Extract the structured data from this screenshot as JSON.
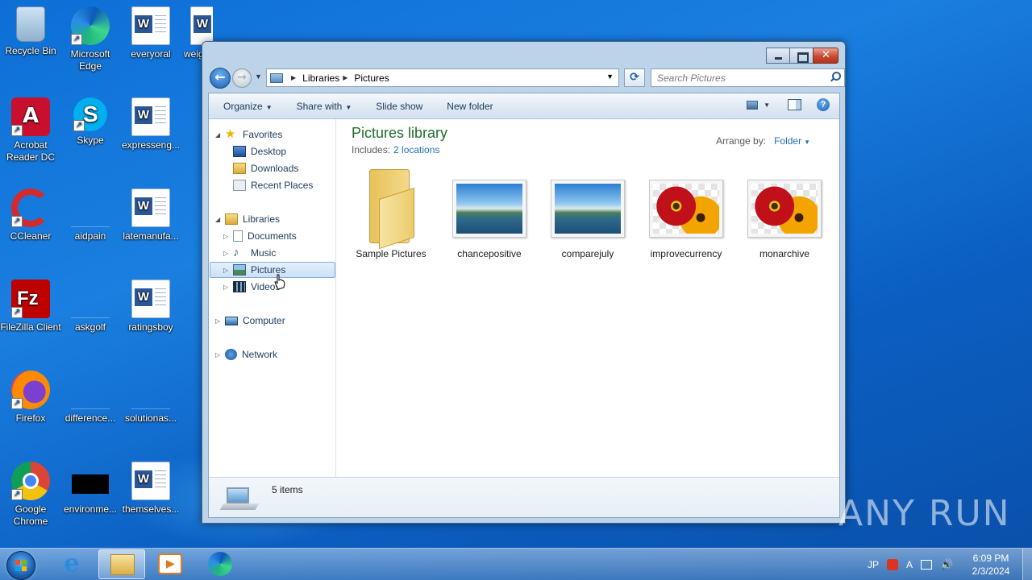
{
  "desktop": {
    "icons": [
      {
        "label": "Recycle Bin"
      },
      {
        "label": "Microsoft Edge"
      },
      {
        "label": "everyoral"
      },
      {
        "label": "weig"
      },
      {
        "label": "Acrobat Reader DC"
      },
      {
        "label": "Skype"
      },
      {
        "label": "expresseng..."
      },
      {
        "label": "CCleaner"
      },
      {
        "label": "aidpain"
      },
      {
        "label": "latemanufa..."
      },
      {
        "label": "FileZilla Client"
      },
      {
        "label": "askgolf"
      },
      {
        "label": "ratingsboy"
      },
      {
        "label": "Firefox"
      },
      {
        "label": "difference..."
      },
      {
        "label": "solutionas..."
      },
      {
        "label": "Google Chrome"
      },
      {
        "label": "environme..."
      },
      {
        "label": "themselves..."
      }
    ]
  },
  "window": {
    "address": {
      "crumbs": [
        "Libraries",
        "Pictures"
      ],
      "search_placeholder": "Search Pictures"
    },
    "toolbar": {
      "organize": "Organize",
      "share_with": "Share with",
      "slide_show": "Slide show",
      "new_folder": "New folder"
    },
    "nav": {
      "favorites": "Favorites",
      "desktop": "Desktop",
      "downloads": "Downloads",
      "recent_places": "Recent Places",
      "libraries": "Libraries",
      "documents": "Documents",
      "music": "Music",
      "pictures": "Pictures",
      "videos": "Videos",
      "computer": "Computer",
      "network": "Network"
    },
    "library": {
      "title": "Pictures library",
      "includes_label": "Includes:",
      "includes_link": "2 locations",
      "arrange_label": "Arrange by:",
      "arrange_value": "Folder"
    },
    "items": [
      {
        "name": "Sample Pictures",
        "kind": "folder"
      },
      {
        "name": "chancepositive",
        "kind": "landscape"
      },
      {
        "name": "comparejuly",
        "kind": "landscape"
      },
      {
        "name": "improvecurrency",
        "kind": "flower"
      },
      {
        "name": "monarchive",
        "kind": "flower"
      }
    ],
    "status": {
      "count": "5 items"
    }
  },
  "watermark": "ANY RUN",
  "taskbar": {
    "tray": {
      "lang": "JP",
      "ime": "A"
    },
    "clock": {
      "time": "6:09 PM",
      "date": "2/3/2024"
    }
  }
}
